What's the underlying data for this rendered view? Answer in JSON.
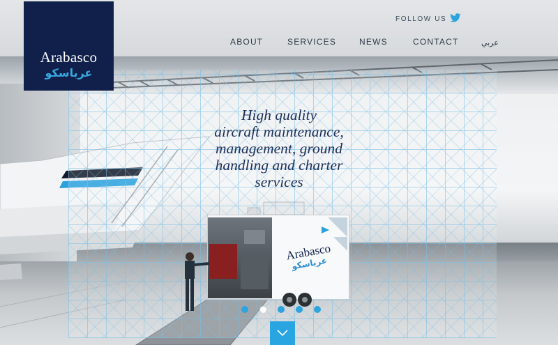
{
  "brand": {
    "name_en": "Arabasco",
    "name_ar": "عرباسكو",
    "navy": "#10204a",
    "accent": "#29a6e2"
  },
  "header": {
    "follow_label": "FOLLOW US",
    "follow_icon": "twitter-icon",
    "nav": [
      {
        "label": "ABOUT"
      },
      {
        "label": "SERVICES"
      },
      {
        "label": "NEWS"
      },
      {
        "label": "CONTACT"
      },
      {
        "label": "عربي"
      }
    ]
  },
  "hero": {
    "headline_lines": [
      "High quality",
      "aircraft maintenance,",
      "management, ground",
      "handling and charter",
      "services"
    ],
    "trailer_logo_en": "Arabasco",
    "trailer_logo_ar": "عرباسكو"
  },
  "slider": {
    "slides": 5,
    "active_index": 1,
    "scroll_icon": "chevron-down-icon"
  }
}
